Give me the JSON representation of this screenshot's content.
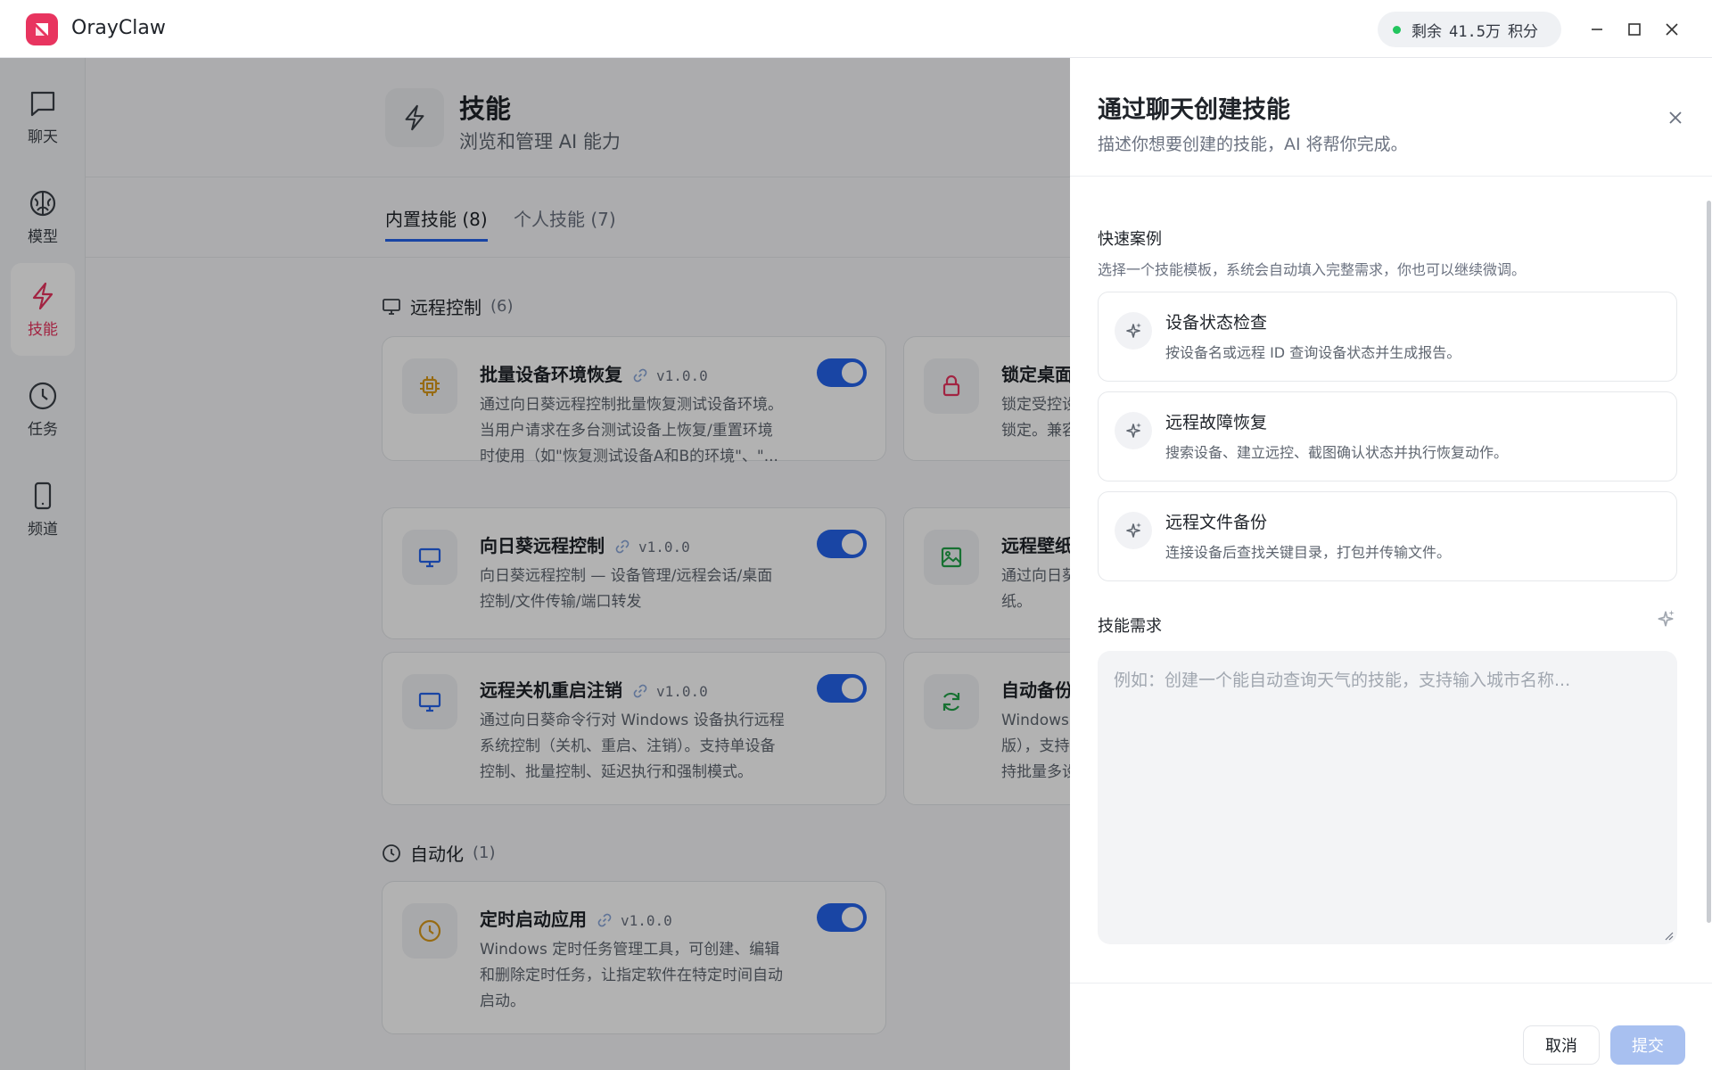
{
  "app": {
    "title": "OrayClaw"
  },
  "credits": {
    "prefix": "剩余",
    "amount": "41.5万",
    "unit": "积分",
    "status_color": "#22c55e"
  },
  "nav": [
    {
      "label": "聊天",
      "icon": "chat-icon",
      "active": false
    },
    {
      "label": "模型",
      "icon": "brain-icon",
      "active": false
    },
    {
      "label": "技能",
      "icon": "lightning-icon",
      "active": true
    },
    {
      "label": "任务",
      "icon": "clock-icon",
      "active": false
    },
    {
      "label": "频道",
      "icon": "phone-icon",
      "active": false
    }
  ],
  "page": {
    "title": "技能",
    "subtitle": "浏览和管理 AI 能力",
    "tabs": [
      {
        "label": "内置技能 (8)",
        "active": true
      },
      {
        "label": "个人技能 (7)",
        "active": false
      }
    ],
    "sections": [
      {
        "title": "远程控制",
        "count": "(6)",
        "icon": "monitor-icon",
        "cards": [
          {
            "name": "批量设备环境恢复",
            "version": "v1.0.0",
            "icon": "chip-icon",
            "icon_color": "#d99a1b",
            "enabled": true,
            "desc": [
              "通过向日葵远程控制批量恢复测试设备环境。",
              "当用户请求在多台测试设备上恢复/重置环境",
              "时使用（如\"恢复测试设备A和B的环境\"、\"..."
            ]
          },
          {
            "name": "锁定桌面",
            "icon": "lock-icon",
            "icon_color": "#e8345f",
            "desc": [
              "锁定受控设",
              "锁定。兼容"
            ]
          },
          {
            "name": "向日葵远程控制",
            "version": "v1.0.0",
            "icon": "monitor-icon",
            "icon_color": "#2563eb",
            "enabled": true,
            "desc": [
              "向日葵远程控制 — 设备管理/远程会话/桌面",
              "控制/文件传输/端口转发"
            ]
          },
          {
            "name": "远程壁纸",
            "icon": "image-icon",
            "icon_color": "#22a348",
            "desc": [
              "通过向日葵",
              "纸。"
            ]
          },
          {
            "name": "远程关机重启注销",
            "version": "v1.0.0",
            "icon": "monitor-icon",
            "icon_color": "#2563eb",
            "enabled": true,
            "desc": [
              "通过向日葵命令行对 Windows 设备执行远程",
              "系统控制（关机、重启、注销）。支持单设备",
              "控制、批量控制、延迟执行和强制模式。"
            ]
          },
          {
            "name": "自动备份",
            "icon": "refresh-icon",
            "icon_color": "#22a348",
            "desc": [
              "Windows",
              "版），支持",
              "持批量多设"
            ]
          }
        ]
      },
      {
        "title": "自动化",
        "count": "(1)",
        "icon": "clock-icon",
        "cards": [
          {
            "name": "定时启动应用",
            "version": "v1.0.0",
            "icon": "clock-icon",
            "icon_color": "#d99a1b",
            "enabled": true,
            "desc": [
              "Windows 定时任务管理工具，可创建、编辑",
              "和删除定时任务，让指定软件在特定时间自动",
              "启动。"
            ]
          }
        ]
      }
    ]
  },
  "drawer": {
    "title": "通过聊天创建技能",
    "subtitle": "描述你想要创建的技能，AI 将帮你完成。",
    "quick_label": "快速案例",
    "quick_hint": "选择一个技能模板，系统会自动填入完整需求，你也可以继续微调。",
    "cases": [
      {
        "title": "设备状态检查",
        "desc": "按设备名或远程 ID 查询设备状态并生成报告。"
      },
      {
        "title": "远程故障恢复",
        "desc": "搜索设备、建立远控、截图确认状态并执行恢复动作。"
      },
      {
        "title": "远程文件备份",
        "desc": "连接设备后查找关键目录，打包并传输文件。"
      }
    ],
    "req_label": "技能需求",
    "req_value": "",
    "req_placeholder": "例如：创建一个能自动查询天气的技能，支持输入城市名称...",
    "cancel_label": "取消",
    "submit_label": "提交"
  }
}
